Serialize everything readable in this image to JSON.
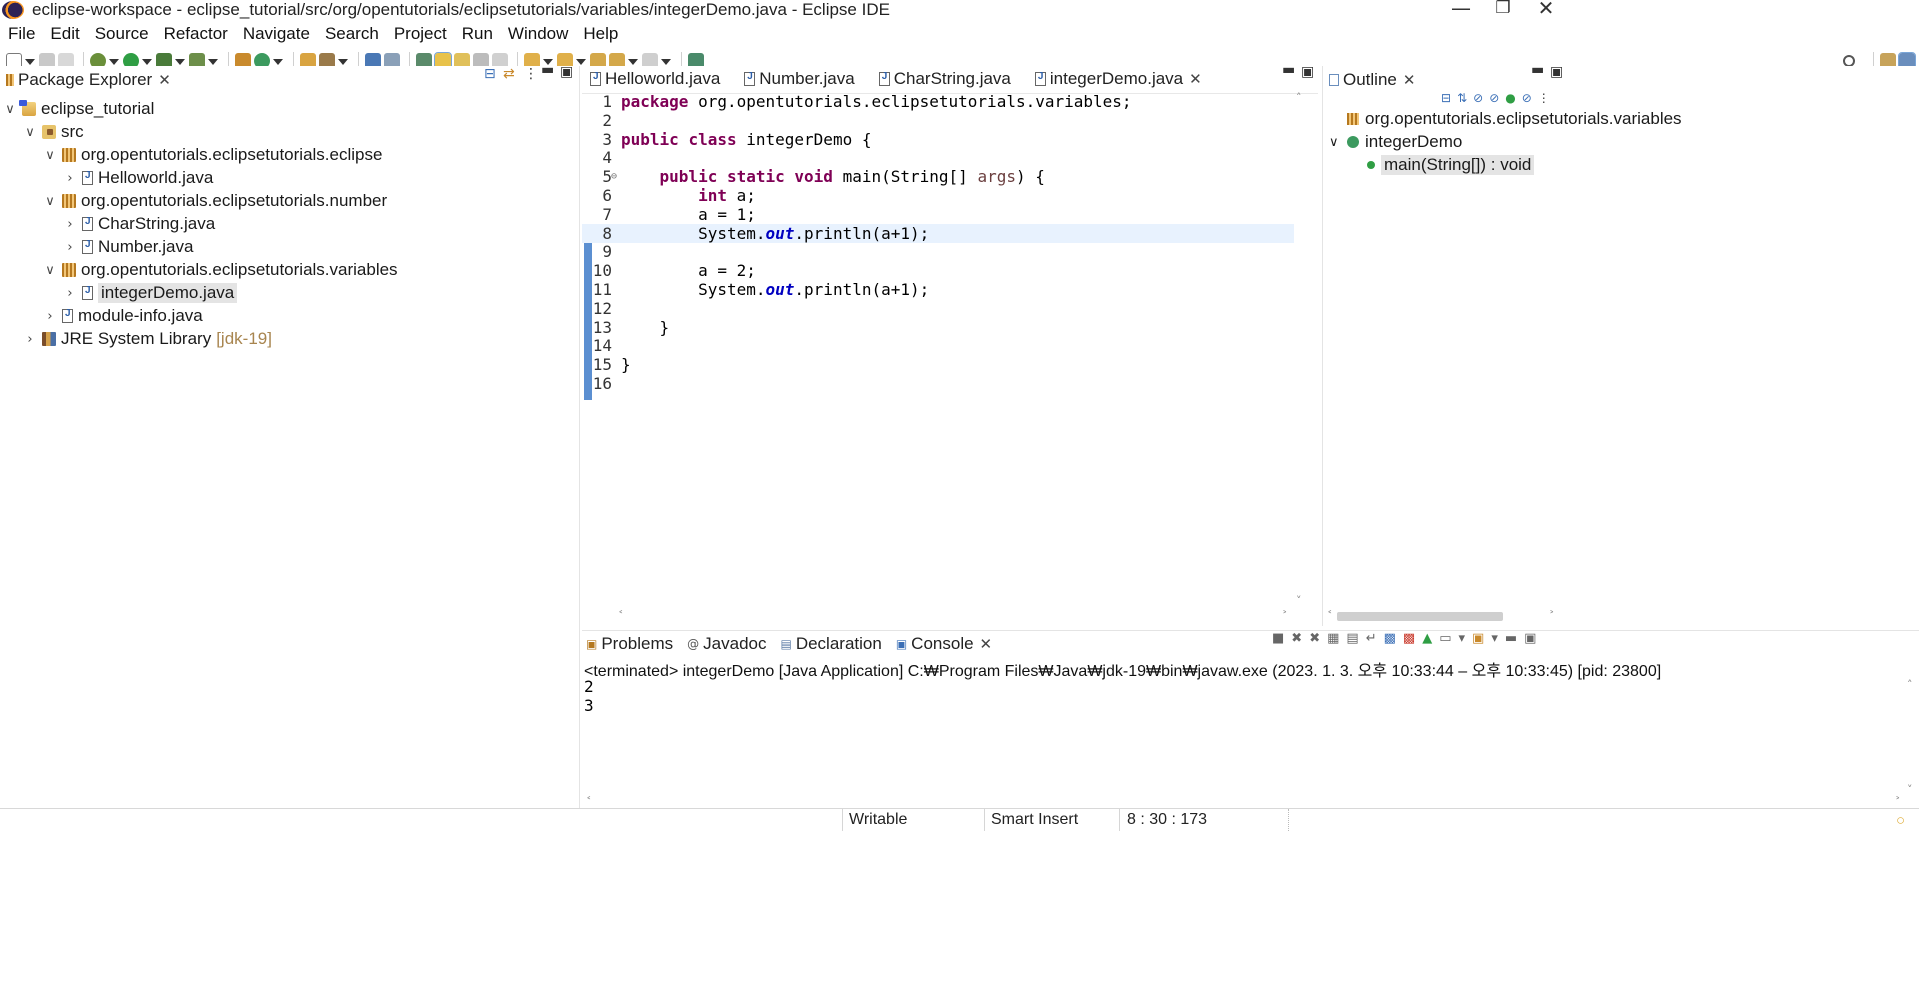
{
  "window": {
    "title": "eclipse-workspace - eclipse_tutorial/src/org/opentutorials/eclipsetutorials/variables/integerDemo.java - Eclipse IDE",
    "controls": [
      "minimize",
      "restore",
      "close"
    ]
  },
  "menu": [
    "File",
    "Edit",
    "Source",
    "Refactor",
    "Navigate",
    "Search",
    "Project",
    "Run",
    "Window",
    "Help"
  ],
  "package_explorer": {
    "tab_label": "Package Explorer",
    "tree": [
      {
        "label": "eclipse_tutorial",
        "level": 0,
        "expanded": true,
        "icon": "project-icon"
      },
      {
        "label": "src",
        "level": 1,
        "expanded": true,
        "icon": "source-folder-icon"
      },
      {
        "label": "org.opentutorials.eclipsetutorials.eclipse",
        "level": 2,
        "expanded": true,
        "icon": "package-icon"
      },
      {
        "label": "Helloworld.java",
        "level": 3,
        "expanded": false,
        "icon": "java-file-icon"
      },
      {
        "label": "org.opentutorials.eclipsetutorials.number",
        "level": 2,
        "expanded": true,
        "icon": "package-icon"
      },
      {
        "label": "CharString.java",
        "level": 3,
        "expanded": false,
        "icon": "java-file-icon"
      },
      {
        "label": "Number.java",
        "level": 3,
        "expanded": false,
        "icon": "java-file-icon"
      },
      {
        "label": "org.opentutorials.eclipsetutorials.variables",
        "level": 2,
        "expanded": true,
        "icon": "package-icon"
      },
      {
        "label": "integerDemo.java",
        "level": 3,
        "expanded": false,
        "selected": true,
        "icon": "java-file-icon"
      },
      {
        "label": "module-info.java",
        "level": 2,
        "expanded": false,
        "icon": "java-file-icon"
      },
      {
        "label": "JRE System Library",
        "decoration": "[jdk-19]",
        "level": 1,
        "expanded": false,
        "icon": "library-icon"
      }
    ]
  },
  "editor": {
    "tabs": [
      {
        "label": "Helloworld.java",
        "active": false
      },
      {
        "label": "Number.java",
        "active": false
      },
      {
        "label": "CharString.java",
        "active": false
      },
      {
        "label": "integerDemo.java",
        "active": true
      }
    ],
    "current_line": 8,
    "lines": [
      "package org.opentutorials.eclipsetutorials.variables;",
      "",
      "public class integerDemo {",
      "",
      "    public static void main(String[] args) {",
      "        int a;",
      "        a = 1;",
      "        System.out.println(a+1);",
      "",
      "        a = 2;",
      "        System.out.println(a+1);",
      "",
      "    }",
      "",
      "}",
      ""
    ]
  },
  "outline": {
    "tab_label": "Outline",
    "items": [
      {
        "label": "org.opentutorials.eclipsetutorials.variables",
        "icon": "package-icon"
      },
      {
        "label": "integerDemo",
        "icon": "class-icon"
      },
      {
        "label": "main(String[]) : void",
        "icon": "method-icon",
        "selected": true
      }
    ]
  },
  "console": {
    "tabs": [
      {
        "label": "Problems",
        "active": false
      },
      {
        "label": "Javadoc",
        "active": false
      },
      {
        "label": "Declaration",
        "active": false
      },
      {
        "label": "Console",
        "active": true
      }
    ],
    "status": "<terminated> integerDemo [Java Application] C:₩Program Files₩Java₩jdk-19₩bin₩javaw.exe  (2023. 1. 3. 오후 10:33:44 – 오후 10:33:45) [pid: 23800]",
    "output": [
      "2",
      "3"
    ]
  },
  "statusbar": {
    "writable": "Writable",
    "insert_mode": "Smart Insert",
    "position": "8 : 30 : 173"
  },
  "colors": {
    "keyword": "#7f0055",
    "static_field": "#0000c0",
    "current_line": "#e8f2fe",
    "selection": "#e4e4e4",
    "decoration": "#a8854f"
  }
}
